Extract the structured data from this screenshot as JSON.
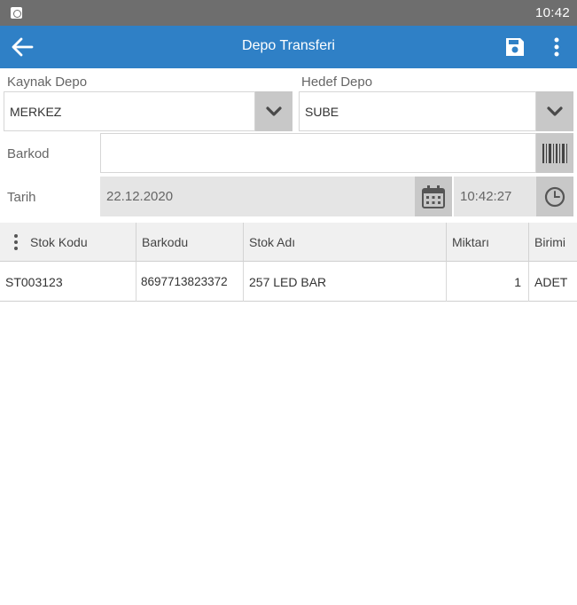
{
  "status_bar": {
    "time": "10:42"
  },
  "toolbar": {
    "title": "Depo Transferi"
  },
  "form": {
    "source_label": "Kaynak Depo",
    "source_value": "MERKEZ",
    "target_label": "Hedef Depo",
    "target_value": "SUBE",
    "barcode_label": "Barkod",
    "barcode_value": "",
    "date_label": "Tarih",
    "date_value": "22.12.2020",
    "time_value": "10:42:27"
  },
  "grid": {
    "columns": [
      "Stok Kodu",
      "Barkodu",
      "Stok Adı",
      "Miktarı",
      "Birimi"
    ],
    "rows": [
      {
        "stock_code": "ST003123",
        "barcode": "8697713823372",
        "stock_name": "257 LED BAR",
        "quantity": "1",
        "unit": "ADET"
      }
    ]
  },
  "colors": {
    "toolbar": "#2f80c6",
    "status_bar": "#6e6e6e",
    "dropdown_button": "#c8c8c8",
    "readonly_field": "#e5e5e5"
  }
}
